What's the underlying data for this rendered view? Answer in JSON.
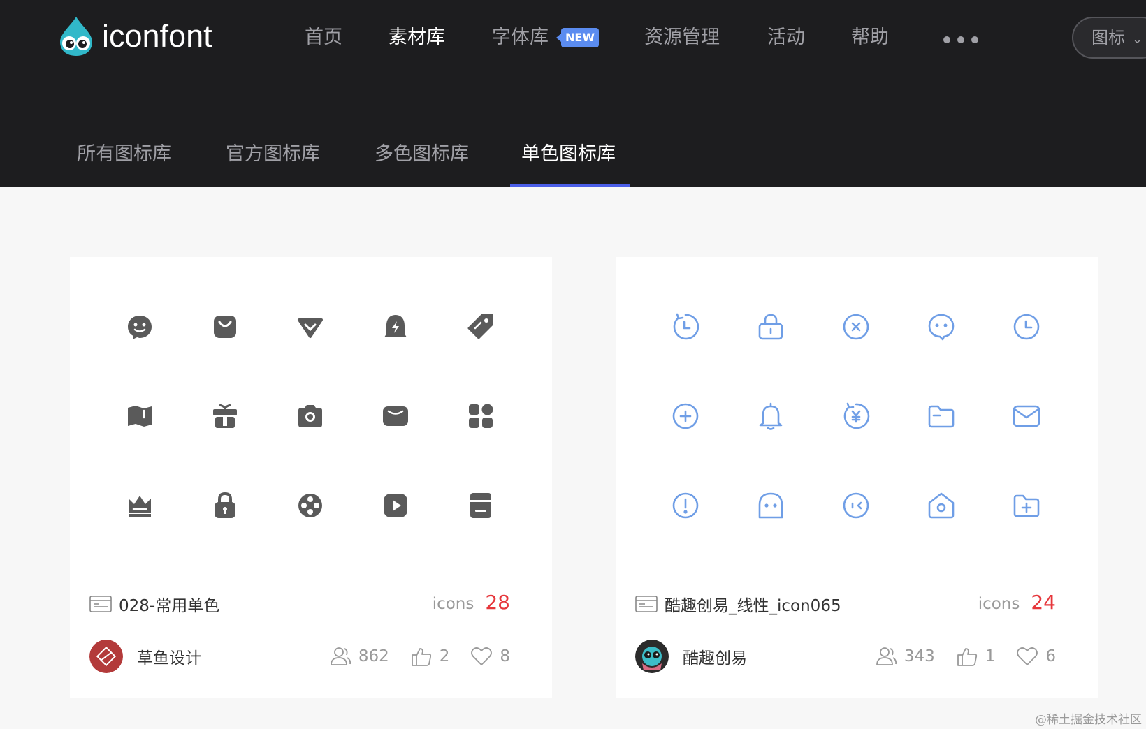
{
  "brand": {
    "name": "iconfont"
  },
  "nav": {
    "items": [
      {
        "label": "首页",
        "active": false
      },
      {
        "label": "素材库",
        "active": true
      },
      {
        "label": "字体库",
        "active": false
      },
      {
        "label": "资源管理",
        "active": false
      },
      {
        "label": "活动",
        "active": false
      },
      {
        "label": "帮助",
        "active": false
      }
    ],
    "new_badge": "NEW",
    "search_type": "图标"
  },
  "tabs": [
    {
      "label": "所有图标库",
      "active": false
    },
    {
      "label": "官方图标库",
      "active": false
    },
    {
      "label": "多色图标库",
      "active": false
    },
    {
      "label": "单色图标库",
      "active": true
    }
  ],
  "cards": [
    {
      "title": "028-常用单色",
      "icons_label": "icons",
      "icons_count": "28",
      "author": "草鱼设计",
      "stats": {
        "users": "862",
        "likes": "2",
        "favorites": "8"
      },
      "icon_color": "#5a5a5a",
      "icons": [
        "smiley-chat-icon",
        "shopping-bag-icon",
        "diamond-icon",
        "flash-bell-icon",
        "tag-icon",
        "map-icon",
        "gift-icon",
        "camera-icon",
        "wallet-icon",
        "apps-icon",
        "crown-icon",
        "lock-icon",
        "film-reel-icon",
        "play-icon",
        "archive-icon"
      ]
    },
    {
      "title": "酷趣创易_线性_icon065",
      "icons_label": "icons",
      "icons_count": "24",
      "author": "酷趣创易",
      "stats": {
        "users": "343",
        "likes": "1",
        "favorites": "6"
      },
      "icon_color": "#6f9ee6",
      "icons": [
        "history-clock-icon",
        "padlock-icon",
        "close-circle-icon",
        "chat-bubble-icon",
        "clock-icon",
        "add-circle-icon",
        "bell-icon",
        "refund-icon",
        "folder-icon",
        "mail-icon",
        "alert-circle-icon",
        "ghost-face-icon",
        "back-face-icon",
        "home-camera-icon",
        "folder-add-icon"
      ]
    }
  ],
  "colors": {
    "accent": "#4b5ee8",
    "count": "#e6363b",
    "header_bg": "#1d1d1f",
    "badge": "#5b8cf0"
  },
  "watermark": "@稀土掘金技术社区"
}
